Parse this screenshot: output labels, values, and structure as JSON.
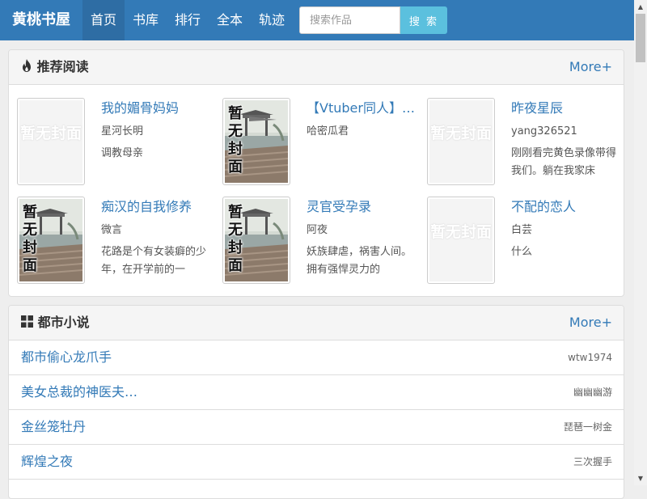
{
  "navbar": {
    "brand": "黄桃书屋",
    "items": [
      {
        "label": "首页",
        "active": true
      },
      {
        "label": "书库",
        "active": false
      },
      {
        "label": "排行",
        "active": false
      },
      {
        "label": "全本",
        "active": false
      },
      {
        "label": "轨迹",
        "active": false
      }
    ],
    "search": {
      "placeholder": "搜索作品",
      "value": "",
      "button_label": "搜 索"
    }
  },
  "recommend": {
    "title": "推荐阅读",
    "more_label": "More+",
    "cover_text": "暂无封面",
    "books": [
      {
        "title": "我的媚骨妈妈",
        "author": "星河长明",
        "desc": "调教母亲",
        "cover": "blank"
      },
      {
        "title": "【Vtuber同人】…",
        "author": "哈密瓜君",
        "desc": "",
        "cover": "image"
      },
      {
        "title": "昨夜星辰",
        "author": "yang326521",
        "desc": "刚刚看完黄色录像带得我们。躺在我家床",
        "cover": "blank"
      },
      {
        "title": "痴汉的自我修养",
        "author": "微言",
        "desc": "花路是个有女装癖的少年，在开学前的一",
        "cover": "image"
      },
      {
        "title": "灵官受孕录",
        "author": "阿夜",
        "desc": "妖族肆虐，祸害人间。拥有强悍灵力的",
        "cover": "image"
      },
      {
        "title": "不配的恋人",
        "author": "白芸",
        "desc": "什么",
        "cover": "blank"
      }
    ]
  },
  "urban": {
    "title": "都市小说",
    "more_label": "More+",
    "rows": [
      {
        "title": "都市偷心龙爪手",
        "author": "wtw1974"
      },
      {
        "title": "美女总裁的神医夫…",
        "author": "幽幽幽游"
      },
      {
        "title": "金丝笼牡丹",
        "author": "琵琶一树金"
      },
      {
        "title": "辉煌之夜",
        "author": "三次握手"
      }
    ]
  },
  "colors": {
    "navbar": "#337ab7",
    "nav_active": "#2e6da4",
    "search_button": "#5bc0de",
    "link": "#337ab7"
  },
  "icons": {
    "recommend_heading": "fire-icon",
    "urban_heading": "grid-icon"
  }
}
